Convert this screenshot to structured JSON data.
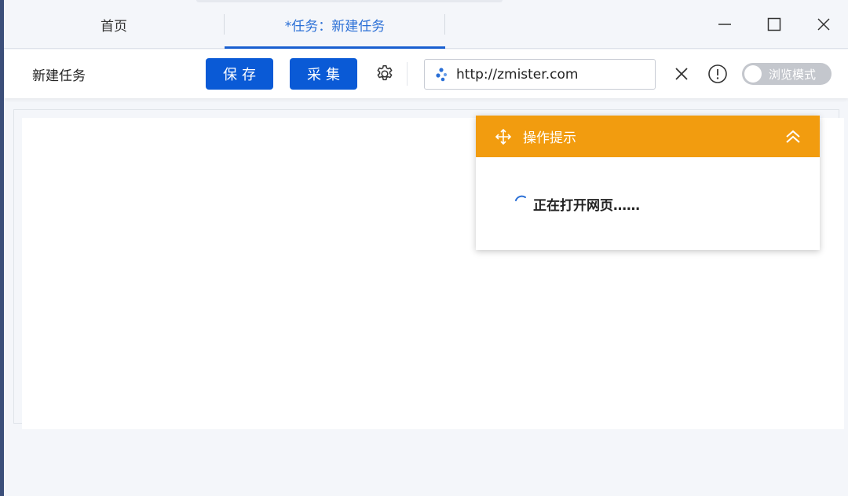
{
  "tabs": {
    "home_label": "首页",
    "task_label": "*任务：新建任务"
  },
  "window_controls": [
    "minimize-icon",
    "maximize-icon",
    "close-icon"
  ],
  "toolbar": {
    "task_title": "新建任务",
    "save_label": "保存",
    "collect_label": "采集",
    "settings_icon": "gear-icon",
    "url_value": "http://zmister.com",
    "clear_icon": "close-icon",
    "info_icon": "info-icon",
    "browse_mode_label": "浏览模式",
    "browse_mode_on": false
  },
  "hint_panel": {
    "title": "操作提示",
    "loading_text": "正在打开网页……"
  },
  "colors": {
    "primary": "#0a5ad6",
    "tab_active": "#2a6fd6",
    "hint_header": "#f29c0f",
    "toggle_off": "#c4c7cd"
  }
}
